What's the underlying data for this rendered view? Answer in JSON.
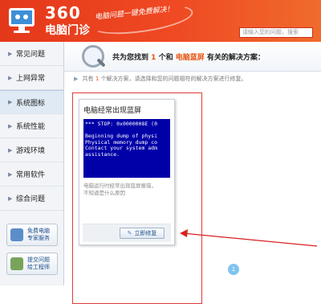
{
  "header": {
    "logo_number": "360",
    "logo_subtitle": "电脑门诊",
    "slogan": "电脑问题一键免费解决！",
    "search_placeholder": "请输入您的问题，搜索"
  },
  "sidebar": {
    "items": [
      {
        "label": "常见问题"
      },
      {
        "label": "上网异常"
      },
      {
        "label": "系统图标"
      },
      {
        "label": "系统性能"
      },
      {
        "label": "游戏环境"
      },
      {
        "label": "常用软件"
      },
      {
        "label": "综合问题"
      }
    ],
    "active_index": 2,
    "buttons": [
      {
        "line1": "免费电脑",
        "line2": "专家服务"
      },
      {
        "line1": "提交问题",
        "line2": "给工程师"
      }
    ]
  },
  "result": {
    "prefix": "共为您找到",
    "count": "1",
    "mid": "个和",
    "keyword": "电脑蓝屏",
    "suffix": "有关的解决方案：",
    "note_prefix": "共有",
    "note_count": "1",
    "note_suffix": "个解决方案，请选择和您的问题相符的解决方案进行修复。"
  },
  "card": {
    "title": "电脑经常出现蓝屏",
    "bsod_lines": [
      "*** STOP: 0x0000008E (0",
      "",
      "Beginning dump of physi",
      "Physical memory dump co",
      "Contact your system adm",
      "assistance."
    ],
    "desc_line1": "电脑运行时经常出现蓝屏报错，",
    "desc_line2": "不知道是什么原因",
    "fix_label": "立即修复"
  },
  "pagination": {
    "current": "1"
  },
  "colors": {
    "header": "#ef4a23",
    "highlight": "#e8520f",
    "bsod": "#0000a8",
    "outline": "#e03a3a"
  }
}
